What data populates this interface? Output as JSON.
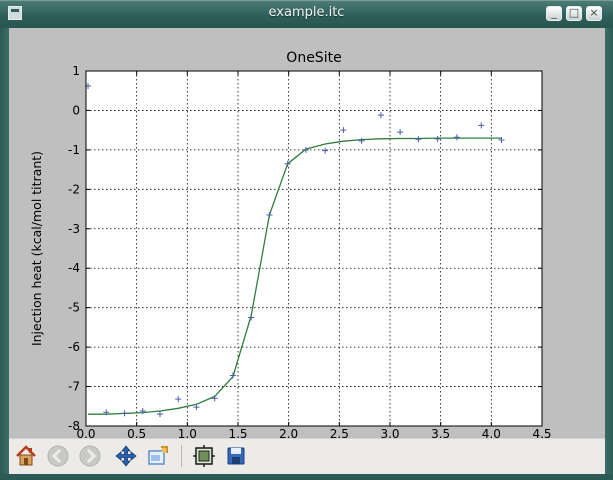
{
  "window": {
    "title": "example.itc",
    "controls": {
      "minimize": "_",
      "maximize": "□",
      "close": "×"
    }
  },
  "toolbar": {
    "buttons": [
      {
        "name": "home-button",
        "icon": "home-icon",
        "enabled": true
      },
      {
        "name": "back-button",
        "icon": "back-arrow-icon",
        "enabled": false
      },
      {
        "name": "forward-button",
        "icon": "forward-arrow-icon",
        "enabled": false
      },
      {
        "name": "pan-button",
        "icon": "pan-arrows-icon",
        "enabled": true
      },
      {
        "name": "zoom-button",
        "icon": "zoom-rect-icon",
        "enabled": true
      },
      {
        "name": "subplots-button",
        "icon": "subplots-config-icon",
        "enabled": true
      },
      {
        "name": "save-button",
        "icon": "floppy-disk-icon",
        "enabled": true
      }
    ]
  },
  "colors": {
    "fit_line": "#2f7d3e",
    "points": "#4a5fa8",
    "plot_bg": "#ffffff",
    "figure_bg": "#bfbfbf"
  },
  "chart_data": {
    "type": "scatter",
    "title": "OneSite",
    "xlabel": "",
    "ylabel": "Injection heat (kcal/mol titrant)",
    "xlim": [
      0.0,
      4.5
    ],
    "ylim": [
      -8,
      1
    ],
    "xticks": [
      0.0,
      0.5,
      1.0,
      1.5,
      2.0,
      2.5,
      3.0,
      3.5,
      4.0,
      4.5
    ],
    "xtick_labels": [
      "0.0",
      "0.5",
      "1.0",
      "1.5",
      "2.0",
      "2.5",
      "3.0",
      "3.5",
      "4.0",
      "4.5"
    ],
    "yticks": [
      1,
      0,
      -1,
      -2,
      -3,
      -4,
      -5,
      -6,
      -7,
      -8
    ],
    "ytick_labels": [
      "1",
      "0",
      "-1",
      "-2",
      "-3",
      "-4",
      "-5",
      "-6",
      "-7",
      "-8"
    ],
    "grid": true,
    "grid_style": "dotted",
    "series": [
      {
        "kind": "markers",
        "marker": "+",
        "x": [
          0.02,
          0.2,
          0.38,
          0.56,
          0.73,
          0.91,
          1.09,
          1.27,
          1.45,
          1.63,
          1.81,
          1.99,
          2.17,
          2.36,
          2.54,
          2.72,
          2.91,
          3.1,
          3.28,
          3.47,
          3.66,
          3.9,
          4.1
        ],
        "y": [
          0.62,
          -7.65,
          -7.68,
          -7.62,
          -7.7,
          -7.32,
          -7.52,
          -7.3,
          -6.72,
          -5.25,
          -2.65,
          -1.35,
          -1.0,
          -1.02,
          -0.5,
          -0.77,
          -0.12,
          -0.55,
          -0.73,
          -0.72,
          -0.68,
          -0.38,
          -0.75
        ]
      },
      {
        "kind": "line",
        "x": [
          0.02,
          0.2,
          0.38,
          0.56,
          0.73,
          0.91,
          1.09,
          1.27,
          1.45,
          1.63,
          1.81,
          1.99,
          2.17,
          2.36,
          2.54,
          2.72,
          2.91,
          3.1,
          3.28,
          3.47,
          3.66,
          3.9,
          4.1
        ],
        "y": [
          -7.7,
          -7.7,
          -7.68,
          -7.66,
          -7.62,
          -7.55,
          -7.45,
          -7.25,
          -6.75,
          -5.2,
          -2.65,
          -1.35,
          -0.98,
          -0.85,
          -0.78,
          -0.74,
          -0.72,
          -0.71,
          -0.71,
          -0.7,
          -0.7,
          -0.7,
          -0.7
        ]
      }
    ]
  }
}
